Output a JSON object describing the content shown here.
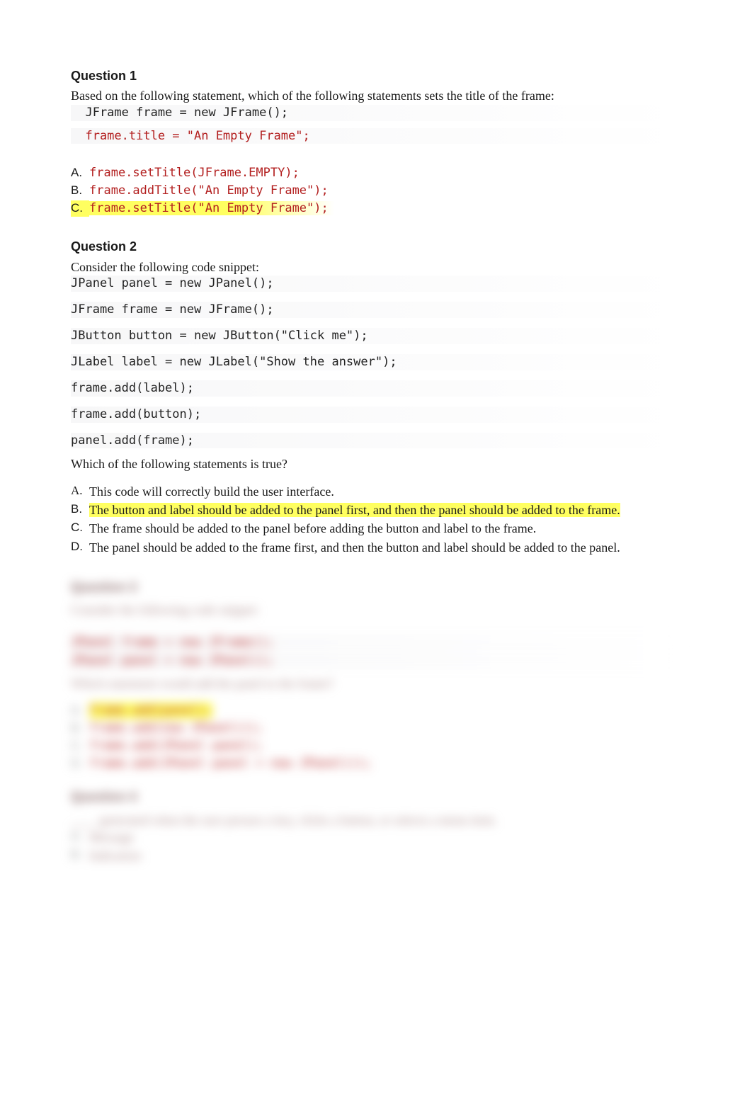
{
  "q1": {
    "title": "Question 1",
    "prompt": "Based on the following statement, which of the following statements sets the title of the frame:",
    "code1": "  JFrame frame = new JFrame();",
    "code2": "  frame.title = \"An Empty Frame\";",
    "options": {
      "a_letter": "A.",
      "a_text": "frame.setTitle(JFrame.EMPTY);",
      "b_letter": "B.",
      "b_text": "frame.addTitle(\"An Empty Frame\");",
      "c_letter": "C.",
      "c_text": "frame.setTitle(\"An Empty Frame\");"
    }
  },
  "q2": {
    "title": "Question 2",
    "prompt": "Consider the following code snippet:",
    "code": {
      "l1": "JPanel panel = new JPanel();",
      "l2": "JFrame frame = new JFrame();",
      "l3": "JButton button = new JButton(\"Click me\");",
      "l4": "JLabel label = new JLabel(\"Show the answer\");",
      "l5": "frame.add(label);",
      "l6": "frame.add(button);",
      "l7": "panel.add(frame);"
    },
    "followup": "Which of the following statements is true?",
    "options": {
      "a_letter": "A.",
      "a_text": "This code will correctly build the user interface.",
      "b_letter": "B.",
      "b_text": "The button and label should be added to the panel first, and then the panel should be added to the frame.",
      "c_letter": "C.",
      "c_text": "The frame should be added to the panel before adding the button and label to the frame.",
      "d_letter": "D.",
      "d_text": "The panel should be added to the frame first, and then the button and label should be added to the panel."
    }
  },
  "blurred": {
    "q3_title": "Question 3",
    "q3_prompt": "Consider the following code snippet:",
    "q3_code1": "JPanel frame = new JFrame();",
    "q3_code2": "JPanel panel = new JPanel();",
    "q3_follow": "Which statement would add the panel to the frame?",
    "q3_a_letter": "A.",
    "q3_a_text": "frame.add(panel);",
    "q3_b_letter": "B.",
    "q3_b_text": "frame.add(new JPanel());",
    "q3_c_letter": "C.",
    "q3_c_text": "frame.add(JPanel panel);",
    "q3_d_letter": "D.",
    "q3_d_text": "frame.add(JPanel panel = new JPanel());",
    "q4_title": "Question 4",
    "q4_prompt": "____ generated when the user presses a key, clicks a button, or selects a menu item.",
    "q4_a_letter": "A.",
    "q4_a_text": "Message",
    "q4_b_letter": "B.",
    "q4_b_text": "Indication"
  }
}
